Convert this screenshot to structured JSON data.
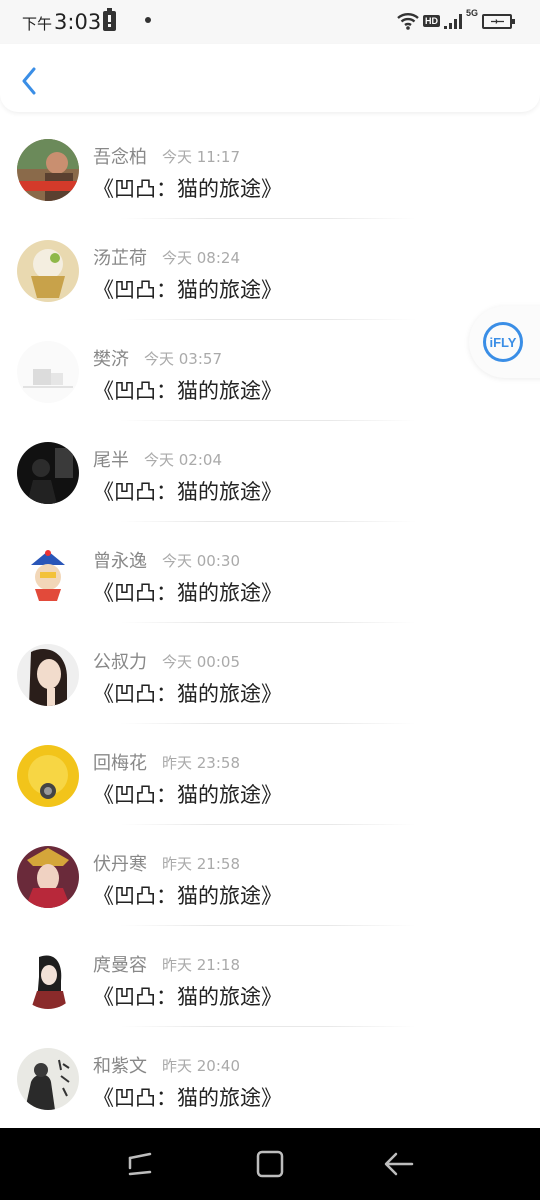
{
  "status_bar": {
    "ampm": "下午",
    "time": "3:03",
    "hd_label": "HD",
    "network_label": "5G"
  },
  "header": {
    "back_icon": "chevron-left-icon"
  },
  "floating_widget": {
    "label": "iFLY"
  },
  "messages": [
    {
      "name": "吾念柏",
      "time": "今天 11:17",
      "message": "《凹凸：猫的旅途》"
    },
    {
      "name": "汤芷荷",
      "time": "今天 08:24",
      "message": "《凹凸：猫的旅途》"
    },
    {
      "name": "樊济",
      "time": "今天 03:57",
      "message": "《凹凸：猫的旅途》"
    },
    {
      "name": "尾半",
      "time": "今天 02:04",
      "message": "《凹凸：猫的旅途》"
    },
    {
      "name": "曾永逸",
      "time": "今天 00:30",
      "message": "《凹凸：猫的旅途》"
    },
    {
      "name": "公叔力",
      "time": "今天 00:05",
      "message": "《凹凸：猫的旅途》"
    },
    {
      "name": "回梅花",
      "time": "昨天 23:58",
      "message": "《凹凸：猫的旅途》"
    },
    {
      "name": "伏丹寒",
      "time": "昨天 21:58",
      "message": "《凹凸：猫的旅途》"
    },
    {
      "name": "庹曼容",
      "time": "昨天 21:18",
      "message": "《凹凸：猫的旅途》"
    },
    {
      "name": "和紫文",
      "time": "昨天 20:40",
      "message": "《凹凸：猫的旅途》"
    }
  ],
  "colors": {
    "accent": "#3a8ee6",
    "name_text": "#888888",
    "time_text": "#aaaaaa",
    "message_text": "#222222"
  }
}
